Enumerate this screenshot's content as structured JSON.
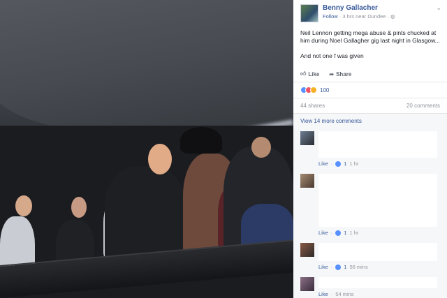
{
  "post": {
    "author": "Benny Gallacher",
    "follow_label": "Follow",
    "meta": " · 3 hrs near Dundee · ",
    "caret": "⌄",
    "text_line1": "Neil Lennon getting mega abuse & pints chucked at him during Noel Gallagher gig last night in Glasgow...",
    "text_line2": "And not one f       was given",
    "like_label": "Like",
    "share_label": "Share",
    "reactions_count": "100",
    "shares": "44 shares",
    "comments_count": "20 comments",
    "view_more": "View 14 more comments"
  },
  "comments": [
    {
      "like_label": "Like",
      "likes": "1",
      "time": "1 hr"
    },
    {
      "like_label": "Like",
      "likes": "1",
      "time": "1 hr"
    },
    {
      "like_label": "Like",
      "likes": "1",
      "time": "56 mins"
    },
    {
      "like_label": "Like",
      "time": "54 mins"
    }
  ],
  "colors": {
    "link": "#365899",
    "muted": "#90949c",
    "like_blue": "#5890ff"
  }
}
